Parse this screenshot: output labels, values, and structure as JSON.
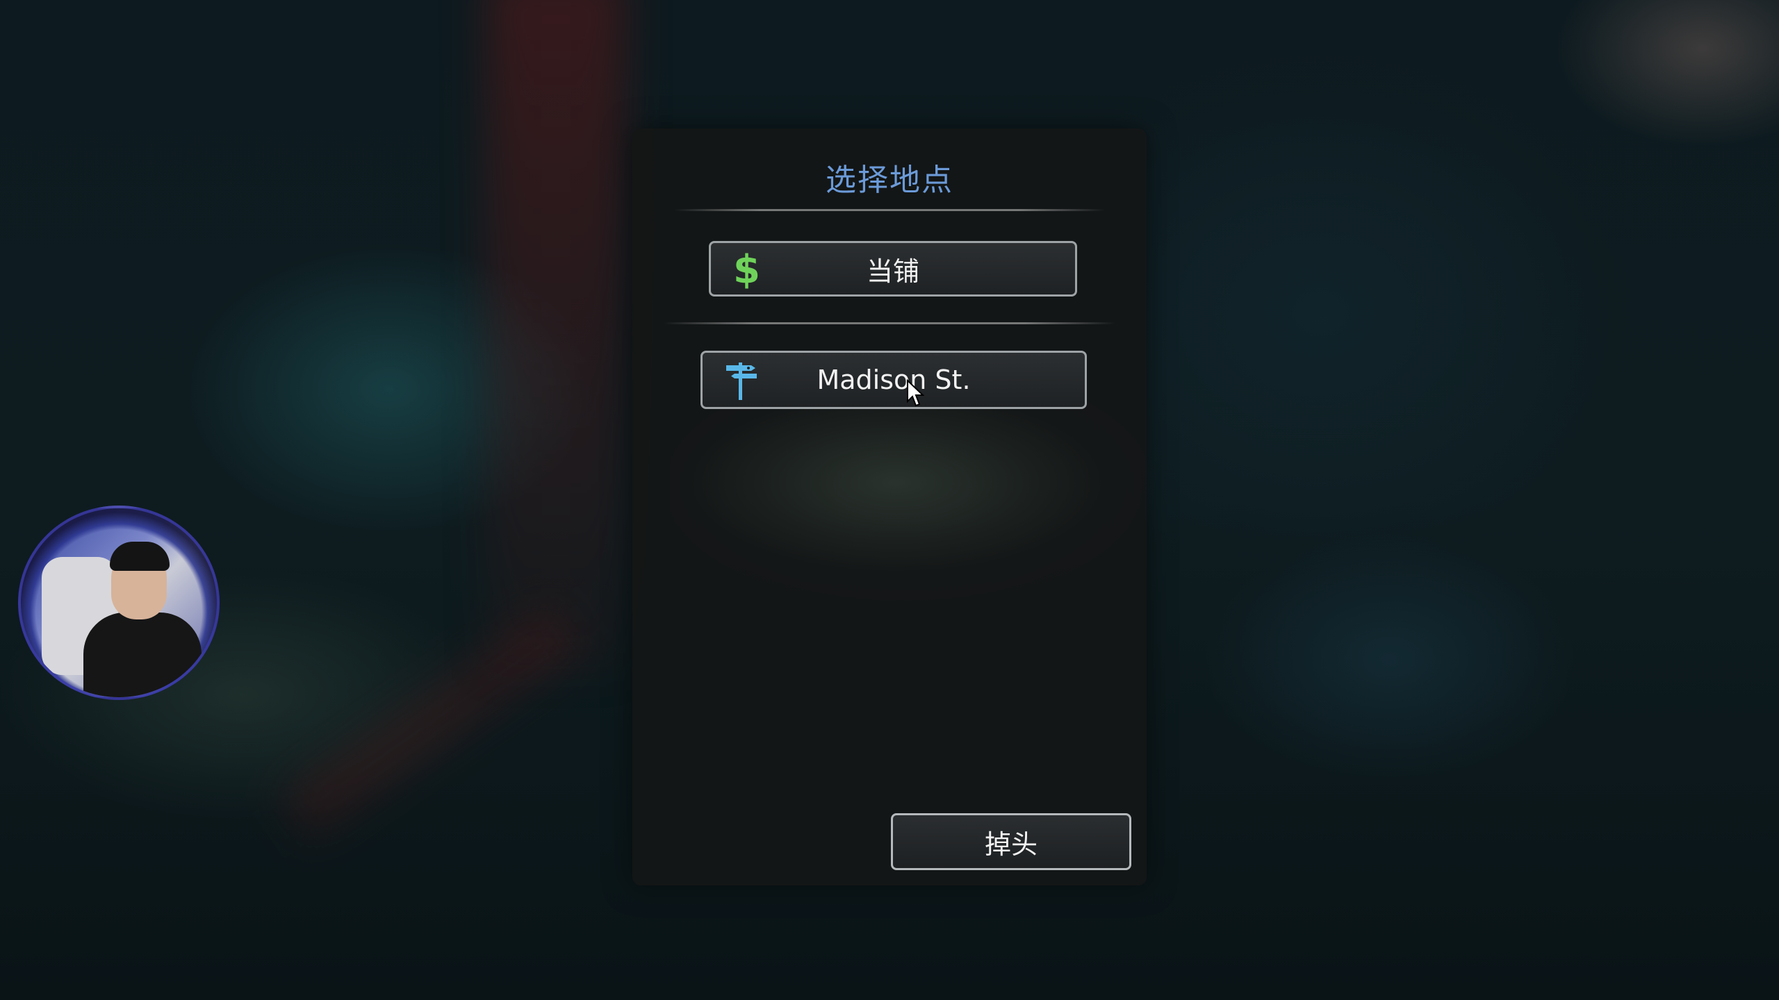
{
  "dialog": {
    "title": "选择地点",
    "locations": [
      {
        "label": "当铺",
        "icon": "dollar-icon",
        "icon_color": "#6fd35a"
      },
      {
        "label": "Madison St.",
        "icon": "signpost-icon",
        "icon_color": "#59b7e8"
      }
    ],
    "turn_around_label": "掉头",
    "title_color": "#6b9ad8"
  },
  "overlay": {
    "webcam": "streamer-webcam"
  }
}
